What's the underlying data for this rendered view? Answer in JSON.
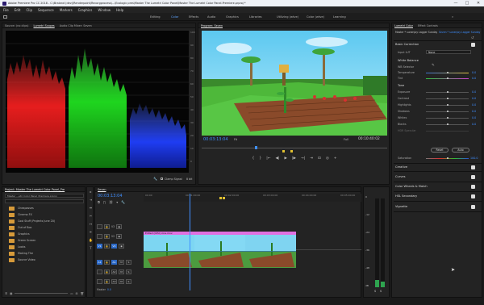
{
  "window": {
    "title": "Adobe Premiere Pro CC 2018 - C:\\Braland (dev)\\Renderpoint\\Recorgprocess\\...\\Ecologic pres\\Master The Lumetri Color Panel\\Master The Lumetri Color Panel.Premiere.prproj *",
    "minimize": "—",
    "maximize": "□",
    "close": "✕"
  },
  "menu": [
    "File",
    "Edit",
    "Clip",
    "Sequence",
    "Markers",
    "Graphics",
    "Window",
    "Help"
  ],
  "workspaces": {
    "tabs": [
      "Editing",
      "Color",
      "Effects",
      "Audio",
      "Graphics",
      "Libraries",
      "Utilizing (wtve)",
      "Color (wtve)",
      "Learning"
    ],
    "active": "Color"
  },
  "scopes_panel": {
    "tabs": [
      "Source: (no clips)",
      "Lumetri Scopes",
      "Audio Clip Mixer: Seven"
    ],
    "active_tab": "Lumetri Scopes",
    "ticks": [
      "100",
      "90",
      "80",
      "70",
      "60",
      "50",
      "40",
      "30",
      "20",
      "10",
      "0"
    ],
    "clamp_label": "Clamp Signal",
    "bit_label": "8 bit"
  },
  "program_panel": {
    "title": "Program: Seven",
    "timecode_current": "00:03:13:04",
    "fit": "Fit",
    "zoom": "Full",
    "timecode_duration": "00:10:40:02",
    "transport": [
      "{",
      "}",
      "|←",
      "◀|",
      "▶",
      "|▶",
      "→|",
      "⇥",
      "⊡",
      "◎",
      "+"
    ]
  },
  "lumetri": {
    "tabs": [
      "Lumetri Color",
      "Effect Controls"
    ],
    "active_tab": "Lumetri Color",
    "clip_master": "Master * sunenjoy Lagger Sunday",
    "clip_instance": "Seven * sunenjoy Lagger Sunday",
    "basic_correction": "Basic Correction",
    "input_lut_label": "Input LUT",
    "input_lut_value": "None",
    "white_balance": "White Balance",
    "wb_selector": "WB Selector",
    "temperature": {
      "label": "Temperature",
      "value": "0.0",
      "level": 0.5
    },
    "tint": {
      "label": "Tint",
      "value": "0.0",
      "level": 0.5
    },
    "tone": "Tone",
    "tone_sliders": [
      {
        "label": "Exposure",
        "value": "0.0",
        "level": 0.5
      },
      {
        "label": "Contrast",
        "value": "0.0",
        "level": 0.5
      },
      {
        "label": "Highlights",
        "value": "0.0",
        "level": 0.5
      },
      {
        "label": "Shadows",
        "value": "0.0",
        "level": 0.5
      },
      {
        "label": "Whites",
        "value": "0.0",
        "level": 0.5
      },
      {
        "label": "Blacks",
        "value": "0.0",
        "level": 0.5
      },
      {
        "label": "HDR Specular",
        "value": "",
        "level": 0.5
      }
    ],
    "reset": "Reset",
    "auto": "Auto",
    "saturation": {
      "label": "Saturation",
      "value": "100.0",
      "level": 0.5
    },
    "sections": [
      "Creative",
      "Curves",
      "Color Wheels & Match",
      "HSL Secondary",
      "Vignette"
    ]
  },
  "project_panel": {
    "title": "Project: Master The Lumetri Color Panel_Pre",
    "search_placeholder": "",
    "path": "Master ...etri Color Panel_Premiere.prproj",
    "bins": [
      "Cheapasses",
      "Cinema FX",
      "Cool Stuff (Projects June 20)",
      "Out of Box",
      "Graphics",
      "Green Screen",
      "Looks",
      "Making The",
      "Source Video"
    ]
  },
  "timeline": {
    "title": "Seven",
    "timecode": "00:03:13:04",
    "ruler": [
      "00:00",
      "00:01:00:00",
      "00:02:00:00",
      "00:03:00:00",
      "00:04:00:00",
      "00:05:00:00"
    ],
    "video_tracks": [
      "V3",
      "V2",
      "V1"
    ],
    "audio_tracks": [
      "A1",
      "A2",
      "A3"
    ],
    "master_label": "Master",
    "master_value": "0.0",
    "clip_label": "Edited (CPU) cine.mov"
  },
  "meters": {
    "ticks": [
      "0",
      "-12",
      "-24",
      "-36",
      "-48",
      "dB"
    ],
    "levels": [
      0.08,
      0.06
    ]
  },
  "colors": {
    "accent": "#3f8eff",
    "clip": "#e070e0",
    "folder": "#d69a3a"
  }
}
